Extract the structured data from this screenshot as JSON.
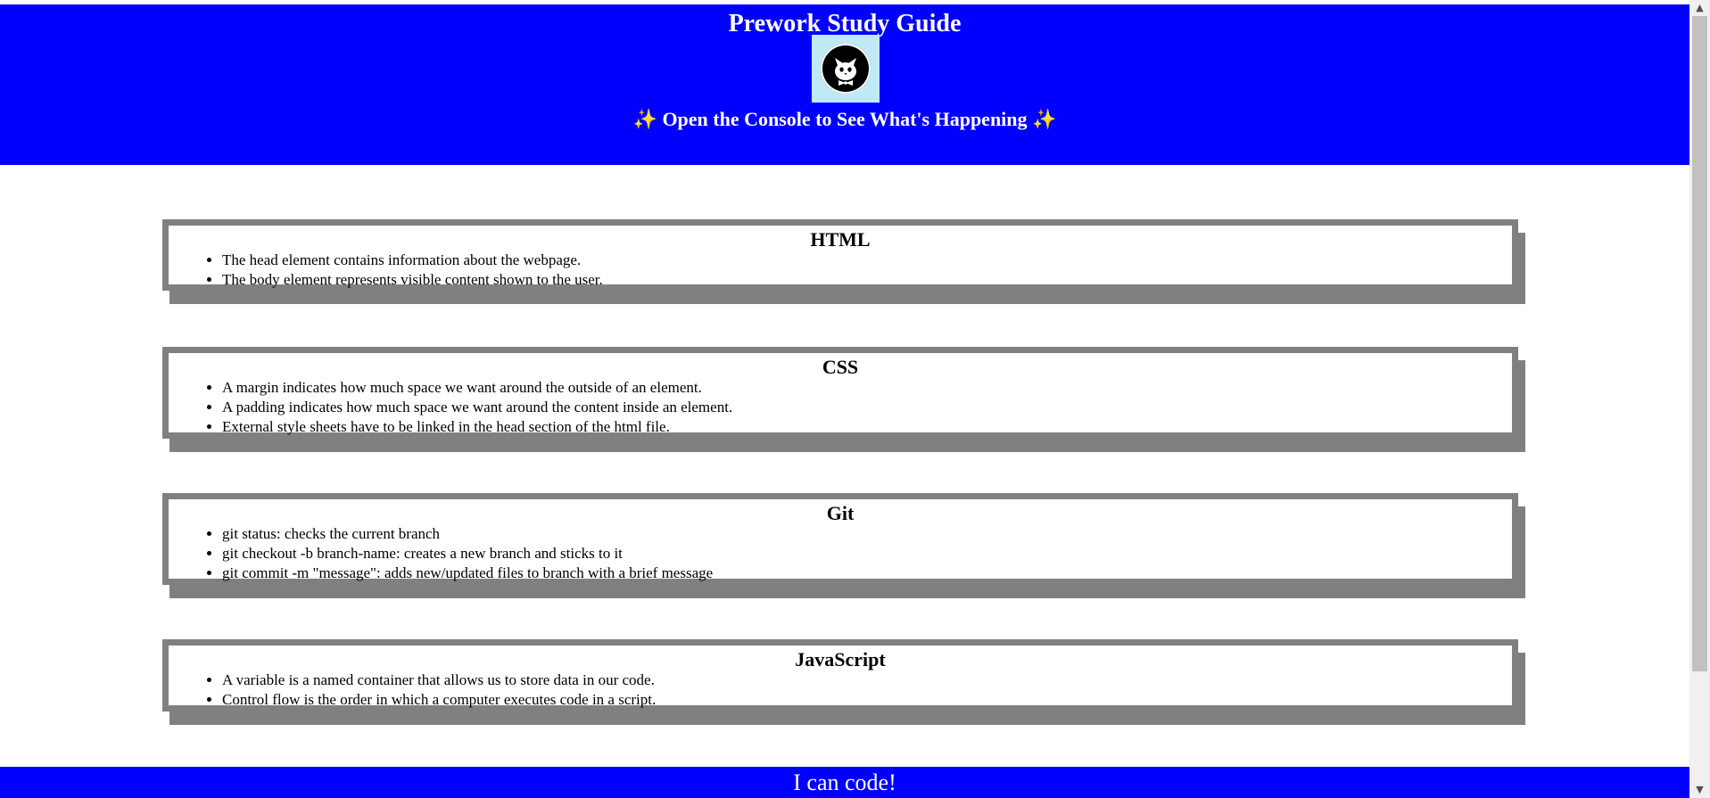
{
  "header": {
    "title": "Prework Study Guide",
    "subtitle": "Open the Console to See What's Happening",
    "sparkle_left": "✨",
    "sparkle_right": "✨",
    "background_color": "#0000ff",
    "avatar_icon": "cat-face-icon"
  },
  "cards": {
    "html": {
      "title": "HTML",
      "items": [
        "The head element contains information about the webpage.",
        "The body element represents visible content shown to the user."
      ]
    },
    "css": {
      "title": "CSS",
      "items": [
        "A margin indicates how much space we want around the outside of an element.",
        "A padding indicates how much space we want around the content inside an element.",
        "External style sheets have to be linked in the head section of the html file."
      ]
    },
    "git": {
      "title": "Git",
      "items": [
        "git status: checks the current branch",
        "git checkout -b branch-name: creates a new branch and sticks to it",
        "git commit -m \"message\": adds new/updated files to branch with a brief message"
      ]
    },
    "javascript": {
      "title": "JavaScript",
      "items": [
        "A variable is a named container that allows us to store data in our code.",
        "Control flow is the order in which a computer executes code in a script."
      ]
    }
  },
  "footer": {
    "text": "I can code!"
  },
  "scrollbar": {
    "up_arrow": "▲",
    "down_arrow": "▼"
  }
}
